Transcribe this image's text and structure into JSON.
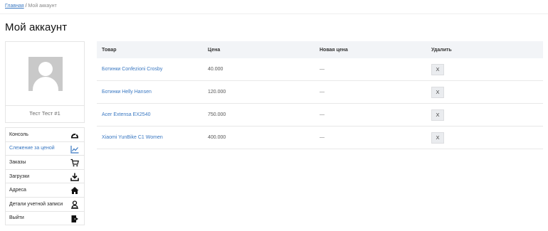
{
  "breadcrumb": {
    "home": "Главная",
    "separator": "/",
    "current": "Мой аккаунт"
  },
  "page_title": "Мой аккаунт",
  "profile": {
    "name": "Тест Тест #1"
  },
  "menu": [
    {
      "label": "Консоль",
      "icon": "dashboard-icon",
      "active": false
    },
    {
      "label": "Слежение за ценой",
      "icon": "chart-line-icon",
      "active": true
    },
    {
      "label": "Заказы",
      "icon": "cart-icon",
      "active": false
    },
    {
      "label": "Загрузки",
      "icon": "download-icon",
      "active": false
    },
    {
      "label": "Адреса",
      "icon": "home-icon",
      "active": false
    },
    {
      "label": "Детали учетной записи",
      "icon": "user-icon",
      "active": false
    },
    {
      "label": "Выйти",
      "icon": "logout-icon",
      "active": false
    }
  ],
  "table": {
    "headers": [
      "Товар",
      "Цена",
      "Новая цена",
      "Удалить"
    ],
    "rows": [
      {
        "product": "Ботинки Confezioni Crosby",
        "price": "40.000",
        "new_price": "—",
        "delete": "X"
      },
      {
        "product": "Ботинки Helly Hansen",
        "price": "120.000",
        "new_price": "—",
        "delete": "X"
      },
      {
        "product": "Acer Extensa EX2540",
        "price": "750.000",
        "new_price": "—",
        "delete": "X"
      },
      {
        "product": "Xiaomi YunBike C1 Women",
        "price": "400.000",
        "new_price": "—",
        "delete": "X"
      }
    ]
  },
  "colors": {
    "link": "#3a78c2",
    "header_bg": "#f2f4f7",
    "border": "#e5e5e5"
  }
}
